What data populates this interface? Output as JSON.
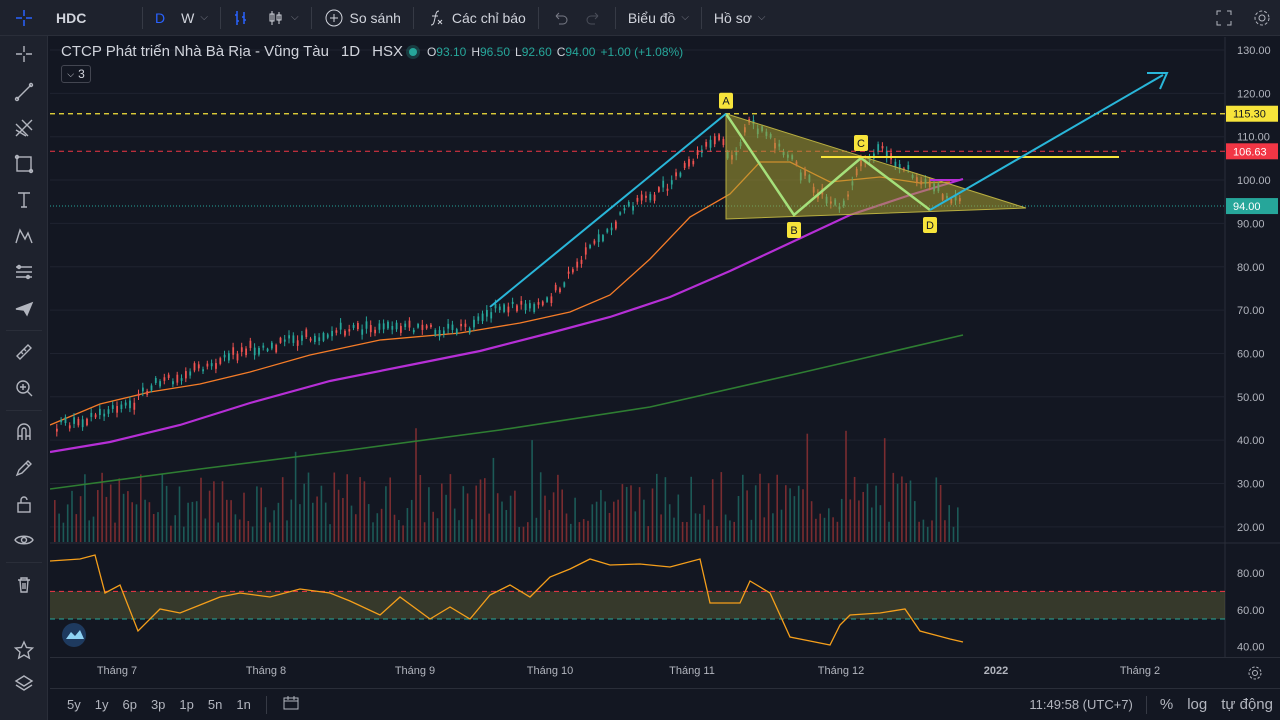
{
  "toolbar": {
    "symbol": "HDC",
    "interval_d": "D",
    "interval_w": "W",
    "compare": "So sánh",
    "indicators": "Các chỉ báo",
    "chart_menu": "Biểu đồ",
    "profile_menu": "Hồ sơ"
  },
  "legend": {
    "name": "CTCP Phát triển Nhà Bà Rịa - Vũng Tàu",
    "interval": "1D",
    "exchange": "HSX",
    "o_label": "O",
    "o": "93.10",
    "h_label": "H",
    "h": "96.50",
    "l_label": "L",
    "l": "92.60",
    "c_label": "C",
    "c": "94.00",
    "change": "+1.00 (+1.08%)",
    "collapsed_count": "3"
  },
  "price_axis": {
    "ticks": [
      "130.00",
      "120.00",
      "110.00",
      "100.00",
      "90.00",
      "80.00",
      "70.00",
      "60.00",
      "50.00",
      "40.00",
      "30.00",
      "20.00"
    ],
    "labels": [
      {
        "text": "115.30",
        "color": "#f7e43b",
        "text_color": "#131722"
      },
      {
        "text": "106.63",
        "color": "#f23645",
        "text_color": "#ffffff"
      },
      {
        "text": "94.00",
        "color": "#26a69a",
        "text_color": "#ffffff"
      }
    ]
  },
  "rsi_axis": {
    "ticks": [
      "80.00",
      "60.00",
      "40.00"
    ]
  },
  "time_axis": [
    "Tháng 7",
    "Tháng 8",
    "Tháng 9",
    "Tháng 10",
    "Tháng 11",
    "Tháng 12",
    "2022",
    "Tháng 2"
  ],
  "pattern_points": [
    "A",
    "B",
    "C",
    "D"
  ],
  "bottom": {
    "ranges": [
      "5y",
      "1y",
      "6p",
      "3p",
      "1p",
      "5n",
      "1n"
    ],
    "clock": "11:49:58 (UTC+7)",
    "percent": "%",
    "log": "log",
    "auto": "tự động"
  },
  "colors": {
    "up": "#26a69a",
    "down": "#ef5350",
    "ma_orange": "#f57c28",
    "ma_purple": "#b62fd6",
    "ma_green": "#2e7d32",
    "trend": "#29b6d9",
    "rsi": "#f59f1b"
  }
}
